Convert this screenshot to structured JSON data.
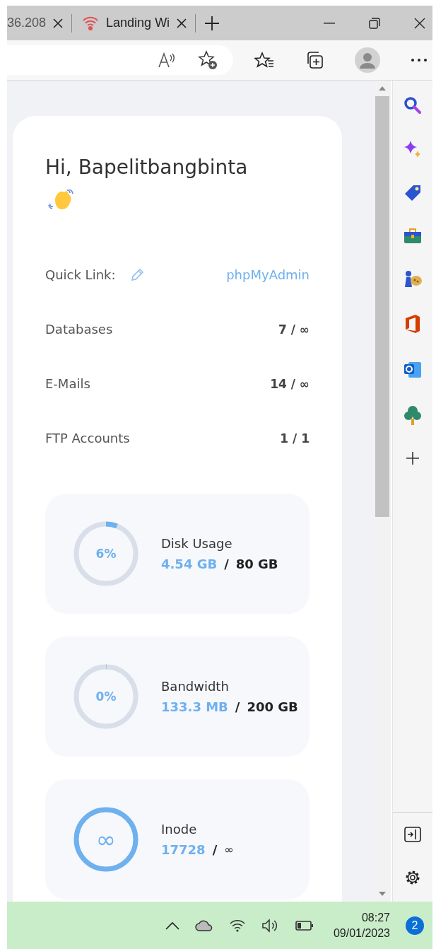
{
  "browser_tabs": [
    {
      "title": "36.208"
    },
    {
      "title": "Landing Wi"
    }
  ],
  "greeting": "Hi, Bapelitbangbinta",
  "quick_link": {
    "label": "Quick Link:",
    "link": "phpMyAdmin"
  },
  "stats_rows": [
    {
      "label": "Databases",
      "value": "7 / ∞"
    },
    {
      "label": "E-Mails",
      "value": "14 / ∞"
    },
    {
      "label": "FTP Accounts",
      "value": "1 / 1"
    }
  ],
  "usage_cards": [
    {
      "kind": "percent",
      "center": "6%",
      "level": 0.06,
      "title": "Disk Usage",
      "used": "4.54 GB",
      "separator": "/",
      "total": "80 GB"
    },
    {
      "kind": "percent",
      "center": "0%",
      "level": 0,
      "title": "Bandwidth",
      "used": "133.3 MB",
      "separator": "/",
      "total": "200 GB"
    },
    {
      "kind": "unlimited",
      "center": "∞",
      "title": "Inode",
      "used": "17728",
      "separator": "/",
      "total": "∞"
    }
  ],
  "taskbar": {
    "time": "08:27",
    "date": "09/01/2023",
    "notifications": "2"
  }
}
